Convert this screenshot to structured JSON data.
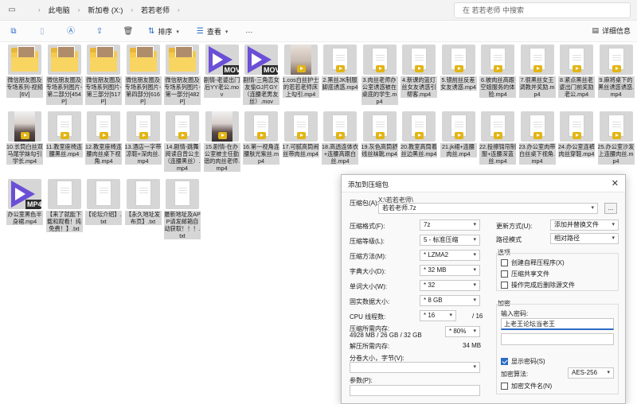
{
  "address": {
    "breadcrumbs": [
      "此电脑",
      "新加卷 (X:)",
      "若若老师"
    ],
    "search_placeholder": "在 若若老师 中搜索"
  },
  "toolbar": {
    "sort_label": "排序",
    "view_label": "查看",
    "more_label": "···",
    "details_label": "详细信息"
  },
  "files": [
    {
      "name": "微信朋友圈及专场系列-视频[6V]",
      "kind": "folder",
      "selected": true
    },
    {
      "name": "微信朋友圈及专场系列图片-第二部分[454P]",
      "kind": "folder",
      "selected": true
    },
    {
      "name": "微信朋友圈及专场系列图片-第三部分[517P]",
      "kind": "folder",
      "selected": true
    },
    {
      "name": "微信朋友圈及专场系列图片-第四部分[616P]",
      "kind": "folder",
      "selected": true
    },
    {
      "name": "微信朋友圈及专场系列图片-第一部分[482P]",
      "kind": "folder",
      "selected": true
    },
    {
      "name": "剧情-老婆出门后YY老公.mov",
      "kind": "mov",
      "selected": true
    },
    {
      "name": "剧情-三角恋女友偷GJ片GY（连腰老男友丝）.mov",
      "kind": "mov",
      "selected": true
    },
    {
      "name": "1.cos白丝护士的若若老师床上勾引.mp4",
      "kind": "photo",
      "selected": true
    },
    {
      "name": "2.黑丝JK制服脚底诱惑.mp4",
      "kind": "doc",
      "selected": true
    },
    {
      "name": "3.肉丝老师办公室诱惑被在桌底的学生.mp4",
      "kind": "doc",
      "selected": true
    },
    {
      "name": "4.新课的篮灯丝女友诱惑引帮客.mp4",
      "kind": "doc",
      "selected": true
    },
    {
      "name": "5.镜前丝反差女友诱惑.mp4",
      "kind": "doc",
      "selected": true
    },
    {
      "name": "6.被肉丝高跟空姐服务的体验.mp4",
      "kind": "doc",
      "selected": true
    },
    {
      "name": "7.很黑丝女王调教并奖励.mp4",
      "kind": "doc",
      "selected": true
    },
    {
      "name": "8.紧点黑丝老婆出门前奖励老公.mp4",
      "kind": "doc",
      "selected": true
    },
    {
      "name": "9.麻将桌下的黑丝诱惑诱惑.mp4",
      "kind": "doc",
      "selected": true
    },
    {
      "name": "10.长筒白丝双马尾学妹勾引学长.mp4",
      "kind": "photo-dark",
      "selected": true
    },
    {
      "name": "11.教室座椅连腰黑丝.mp4",
      "kind": "doc",
      "selected": true
    },
    {
      "name": "12.教室座椅连腰肉丝桌下视角.mp4",
      "kind": "doc",
      "selected": true
    },
    {
      "name": "13.酒店一字带凉鞋+深肉丝.mp4",
      "kind": "doc",
      "selected": true
    },
    {
      "name": "14.剧情-跳舞阅读自曾公主（连腰黑丝）.mp4",
      "kind": "doc",
      "selected": true
    },
    {
      "name": "15.剧情-在办公室被主任勤谐的肉丝老师.mp4",
      "kind": "photo-dark",
      "selected": true
    },
    {
      "name": "16.第一视角连腰肤光紫丝.mp4",
      "kind": "doc",
      "selected": true
    },
    {
      "name": "17.可腻高筒闹丝带肉丝.mp4",
      "kind": "doc",
      "selected": true
    },
    {
      "name": "18.高透连体衣+连腰高跟白丝.mp4",
      "kind": "doc",
      "selected": true
    },
    {
      "name": "19.灰色高筒舒线丝袜靴.mp4",
      "kind": "doc",
      "selected": true
    },
    {
      "name": "20.教室高筒着丝边黑丝.mp4",
      "kind": "doc",
      "selected": true
    },
    {
      "name": "21.jk裙+连腰肉丝.mp4",
      "kind": "doc",
      "selected": true
    },
    {
      "name": "22.投擦锦帘制服+连腰深蓝丝.mp4",
      "kind": "doc",
      "selected": true
    },
    {
      "name": "23.办公室肉带白丝桌下视角.mp4",
      "kind": "doc",
      "selected": true
    },
    {
      "name": "24.办公室连裤肉丝穿鞋.mp4",
      "kind": "doc",
      "selected": true
    },
    {
      "name": "25.办公室沙发上连腰肉丝.mp4",
      "kind": "doc",
      "selected": true
    },
    {
      "name": "办公室黑色半身裙.mp4",
      "kind": "mp4",
      "selected": true
    },
    {
      "name": "【来了就能下载和观看！纯免费！】.txt",
      "kind": "txt",
      "selected": true
    },
    {
      "name": "【论坛介绍】.txt",
      "kind": "txt",
      "selected": true
    },
    {
      "name": "【永久地址发布页】.txt",
      "kind": "txt",
      "selected": true
    },
    {
      "name": "最新地址及APP请发邮箱自动获取！！！.txt",
      "kind": "txt",
      "selected": true
    }
  ],
  "badges": {
    "mov": "MOV",
    "mp4": "MP4"
  },
  "dialog": {
    "title": "添加到压缩包",
    "archive_label": "压缩包(A):",
    "archive_path": "X:\\若若老师\\",
    "archive_name": "若若老师.7z",
    "browse_label": "...",
    "format_label": "压缩格式(F):",
    "format_value": "7z",
    "level_label": "压缩等级(L):",
    "level_value": "5 - 标准压缩",
    "method_label": "压缩方法(M):",
    "method_value": "* LZMA2",
    "dict_label": "字典大小(D):",
    "dict_value": "* 32 MB",
    "word_label": "单词大小(W):",
    "word_value": "* 32",
    "solid_label": "固实数据大小:",
    "solid_value": "* 8 GB",
    "threads_label": "CPU 线程数:",
    "threads_value": "* 16",
    "threads_total": "/ 16",
    "mem_comp_label": "压缩所需内存:",
    "mem_comp_value": "4928 MB / 26 GB / 32 GB",
    "mem_percent": "* 80%",
    "mem_decomp_label": "解压所需内存:",
    "mem_decomp_value": "34 MB",
    "split_label": "分卷大小，字节(V):",
    "params_label": "参数(P):",
    "update_label": "更新方式(U):",
    "update_value": "添加并替换文件",
    "path_label": "路径模式",
    "path_value": "相对路径",
    "options_title": "选项",
    "opt_sfx": "创建自释压程序(X)",
    "opt_shared": "压缩共享文件",
    "opt_delete": "操作完成后删除源文件",
    "encrypt_title": "加密",
    "pwd_label": "输入密码:",
    "pwd_value": "上老王论坛当老王",
    "pwd_confirm": "",
    "show_pwd": "显示密码(S)",
    "enc_method_label": "加密算法:",
    "enc_method_value": "AES-256",
    "enc_names": "加密文件名(N)"
  }
}
